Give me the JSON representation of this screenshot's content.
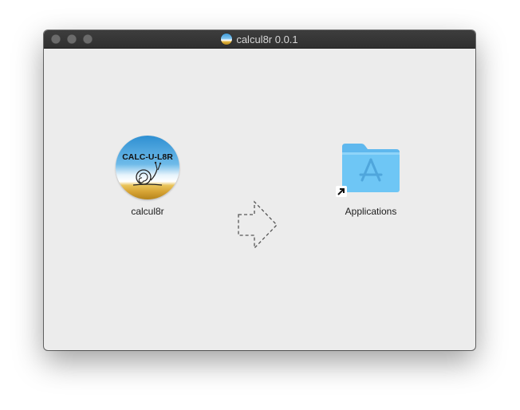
{
  "window": {
    "title": "calcul8r 0.0.1",
    "traffic_lights": [
      "close",
      "minimize",
      "zoom"
    ]
  },
  "items": {
    "app": {
      "label": "calcul8r",
      "icon": "calcul8r-app-icon",
      "logo_text": "CALC-U-L8R"
    },
    "applications": {
      "label": "Applications",
      "icon": "applications-folder-icon",
      "alias_badge": "alias-arrow-icon"
    }
  },
  "drop_hint": {
    "icon": "dashed-right-arrow-icon"
  },
  "colors": {
    "window_bg": "#ececec",
    "titlebar": "#353535",
    "folder": "#6ec6f5",
    "logo_text": "#111111"
  }
}
